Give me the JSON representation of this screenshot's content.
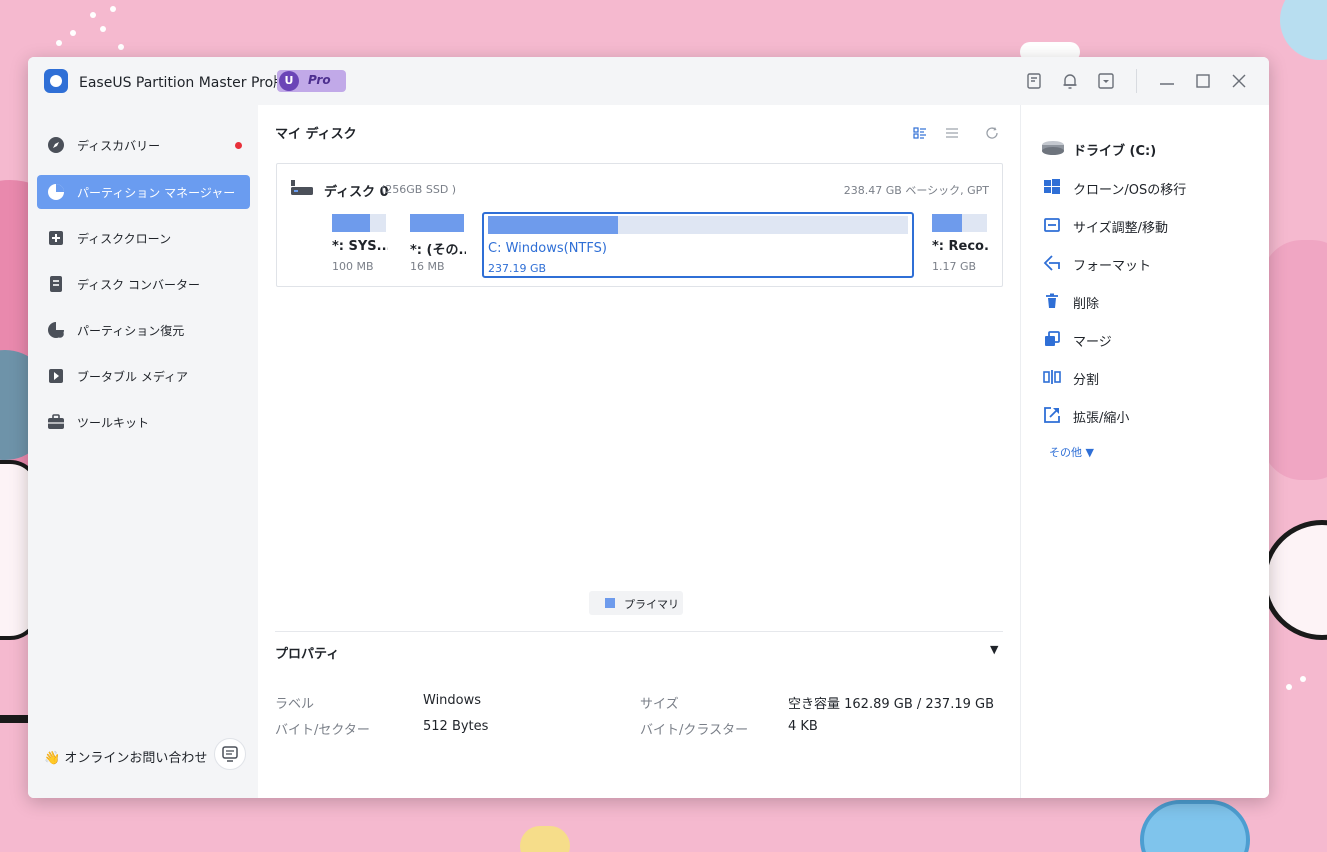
{
  "app": {
    "title": "EaseUS Partition Master Pro版",
    "badge_letter": "U",
    "badge_text": "Pro"
  },
  "sidebar": {
    "items": [
      {
        "label": "ディスカバリー",
        "icon": "compass-icon"
      },
      {
        "label": "パーティション マネージャー",
        "icon": "pie-chart-icon"
      },
      {
        "label": "ディスククローン",
        "icon": "disk-clone-icon"
      },
      {
        "label": "ディスク コンバーター",
        "icon": "disk-convert-icon"
      },
      {
        "label": "パーティション復元",
        "icon": "partition-recovery-icon"
      },
      {
        "label": "ブータブル メディア",
        "icon": "bootable-media-icon"
      },
      {
        "label": "ツールキット",
        "icon": "toolbox-icon"
      }
    ],
    "active_index": 1,
    "contact_label": "👋 オンラインお問い合わせ"
  },
  "main": {
    "section_title": "マイ ディスク",
    "disk": {
      "name": "ディスク 0",
      "sub": "(256GB SSD )",
      "info": "238.47 GB ベーシック, GPT",
      "partitions": [
        {
          "name": "*: SYS...",
          "size": "100 MB",
          "used": 0.7
        },
        {
          "name": "*: (その...",
          "size": "16 MB",
          "used": 1.0
        },
        {
          "name": "C: Windows(NTFS)",
          "size": "237.19 GB",
          "used": 0.31
        },
        {
          "name": "*: Reco...",
          "size": "1.17 GB",
          "used": 0.55
        }
      ],
      "selected_index": 2
    },
    "legend": "プライマリ",
    "properties": {
      "title": "プロパティ",
      "toggle": "▼",
      "rows": [
        {
          "key": "ラベル",
          "value": "Windows"
        },
        {
          "key": "サイズ",
          "value": "空き容量 162.89 GB / 237.19 GB"
        },
        {
          "key": "バイト/セクター",
          "value": "512 Bytes"
        },
        {
          "key": "バイト/クラスター",
          "value": "4 KB"
        }
      ]
    }
  },
  "actions": {
    "items": [
      {
        "label": "ドライブ (C:)",
        "icon": "drive-icon"
      },
      {
        "label": "クローン/OSの移行",
        "icon": "windows-icon"
      },
      {
        "label": "サイズ調整/移動",
        "icon": "resize-icon"
      },
      {
        "label": "フォーマット",
        "icon": "format-icon"
      },
      {
        "label": "削除",
        "icon": "trash-icon"
      },
      {
        "label": "マージ",
        "icon": "merge-icon"
      },
      {
        "label": "分割",
        "icon": "split-icon"
      },
      {
        "label": "拡張/縮小",
        "icon": "extend-icon"
      }
    ],
    "more_label": "その他  ▼"
  },
  "colors": {
    "accent": "#2f6fd6",
    "active_nav": "#6a9cf0",
    "partition_fill": "#6e9bec",
    "notification_dot": "#e8303a"
  }
}
